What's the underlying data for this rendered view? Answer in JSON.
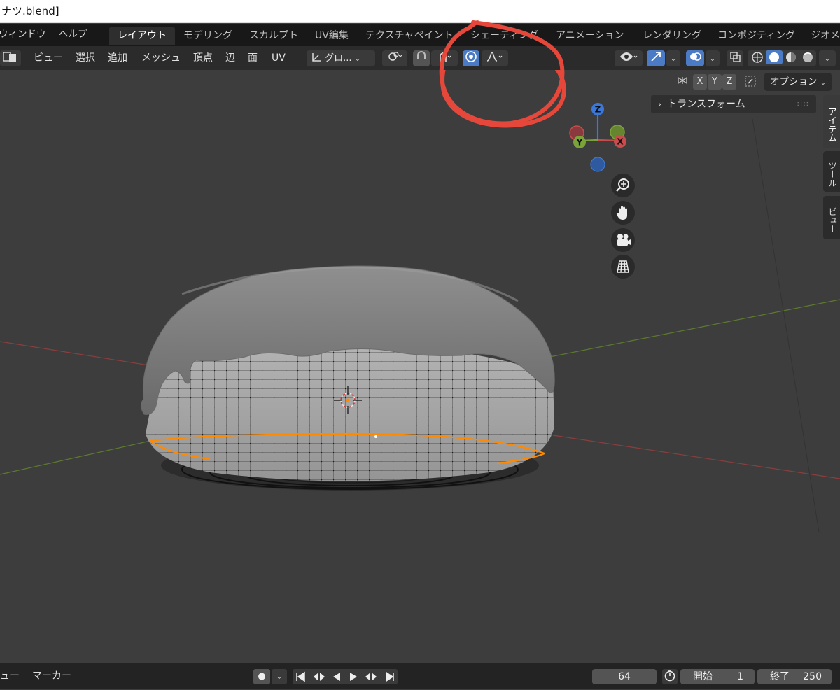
{
  "window": {
    "title": "ナツ.blend]"
  },
  "topbar": {
    "menus": [
      "ウィンドウ",
      "ヘルプ"
    ],
    "workspaces": [
      "レイアウト",
      "モデリング",
      "スカルプト",
      "UV編集",
      "テクスチャペイント",
      "シェーディング",
      "アニメーション",
      "レンダリング",
      "コンポジティング",
      "ジオメ"
    ]
  },
  "header": {
    "menus": [
      "ビュー",
      "選択",
      "追加",
      "メッシュ",
      "頂点",
      "辺",
      "面",
      "UV"
    ],
    "transform_orientation": "グロ...",
    "axes": [
      "X",
      "Y",
      "Z"
    ],
    "options_label": "オプション"
  },
  "npanel": {
    "section": "トランスフォーム",
    "tabs": [
      "アイテム",
      "ツール",
      "ビュー"
    ]
  },
  "gizmo": {
    "x": "X",
    "y": "Y",
    "z": "Z"
  },
  "timeline": {
    "menus": [
      "ュー",
      "マーカー"
    ],
    "current_frame": "64",
    "start_label": "開始",
    "start_value": "1",
    "end_label": "終了",
    "end_value": "250"
  },
  "colors": {
    "annotation": "#e5483b",
    "selected_vertex": "#ff8a00",
    "x_axis": "#c94b4b",
    "y_axis": "#7aa33a",
    "z_axis": "#3c78d8"
  }
}
